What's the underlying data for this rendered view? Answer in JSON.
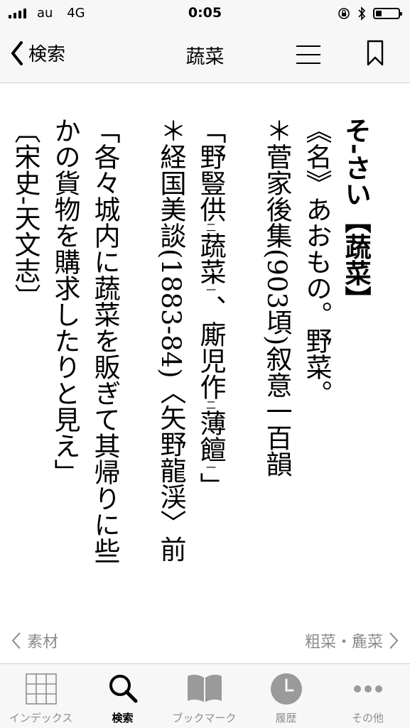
{
  "status_bar": {
    "carrier": "au",
    "network": "4G",
    "time": "0:05",
    "battery_level_percent": 25,
    "icons": [
      "signal-bars-icon",
      "orientation-lock-icon",
      "bluetooth-icon",
      "battery-icon"
    ]
  },
  "nav": {
    "back_label": "検索",
    "title": "蔬菜",
    "icons": [
      "chevron-left-icon",
      "menu-icon",
      "bookmark-icon"
    ]
  },
  "entry": {
    "headword_reading": "そ‐さい",
    "headword_kanji": "【蔬菜】",
    "pos": "《名》",
    "definition": "あおもの。野菜。",
    "cite1_source": "＊菅家後集(903頃)叙意一百韻",
    "cite1_quote_a": "「野豎供",
    "cite1_mark_a": "二",
    "cite1_quote_b": "蔬菜",
    "cite1_mark_b": "一",
    "cite1_quote_c": "、廝児作",
    "cite1_mark_c": "二",
    "cite1_quote_d": "薄饘",
    "cite1_mark_d": "一",
    "cite1_quote_close": "」",
    "cite2_source": "＊経国美談(1883‐84)〈矢野龍渓〉前",
    "cite2_line1": "「各々城内に蔬菜を販ぎて其帰りに些",
    "cite2_line2": "かの貨物を購求したりと見え」",
    "cite3": "〔宋史‐天文志〕"
  },
  "pager": {
    "prev_label": "素材",
    "next_label": "粗菜・麁菜"
  },
  "tabbar": {
    "tabs": [
      {
        "label": "インデックス",
        "icon": "grid-icon"
      },
      {
        "label": "検索",
        "icon": "search-icon"
      },
      {
        "label": "ブックマーク",
        "icon": "book-icon"
      },
      {
        "label": "履歴",
        "icon": "clock-icon"
      },
      {
        "label": "その他",
        "icon": "more-icon"
      }
    ],
    "active_index": 1
  },
  "colors": {
    "bar_background": "#f7f7f7",
    "inactive": "#8e8e8e",
    "active": "#000000"
  }
}
